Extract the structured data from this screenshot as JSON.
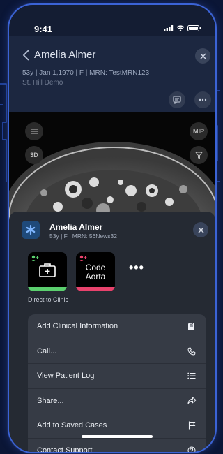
{
  "status_bar": {
    "time": "9:41"
  },
  "header": {
    "patient_name": "Amelia Almer",
    "meta": "53y | Jan 1,1970 | F | MRN: TestMRN123",
    "facility": "St. Hill Demo"
  },
  "viewer": {
    "mip_label": "MIP",
    "mode_3d_label": "3D"
  },
  "sheet": {
    "patient_name": "Amelia Almer",
    "meta": "53y | F | MRN: 56News32",
    "tiles": [
      {
        "name": "direct-to-clinic",
        "label": "",
        "bar_color": "#5bcf6e"
      },
      {
        "name": "code-aorta",
        "label_line1": "Code",
        "label_line2": "Aorta",
        "bar_color": "#e8426c"
      }
    ],
    "tile_caption": "Direct to Clinic",
    "more_label": "•••",
    "menu": [
      {
        "label": "Add Clinical Information",
        "icon": "clipboard-icon"
      },
      {
        "label": "Call...",
        "icon": "phone-icon"
      },
      {
        "label": "View Patient Log",
        "icon": "list-icon"
      },
      {
        "label": "Share...",
        "icon": "share-icon"
      },
      {
        "label": "Add to Saved Cases",
        "icon": "flag-icon"
      },
      {
        "label": "Contact Support",
        "icon": "help-icon"
      }
    ]
  },
  "colors": {
    "accent_green": "#5bcf6e",
    "accent_pink": "#e8426c",
    "frame_blue": "#3b63d6"
  }
}
